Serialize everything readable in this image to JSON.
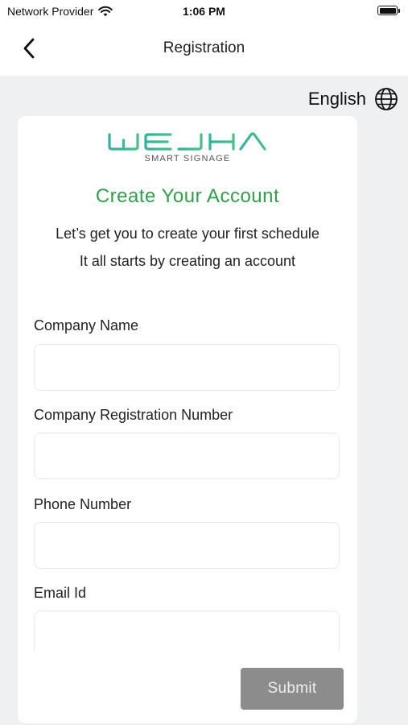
{
  "status_bar": {
    "carrier": "Network Provider",
    "time": "1:06 PM",
    "icons": [
      "wifi-icon",
      "battery-icon"
    ]
  },
  "nav": {
    "title": "Registration",
    "back_icon": "chevron-left-icon"
  },
  "language": {
    "label": "English",
    "icon": "globe-icon"
  },
  "logo": {
    "name": "WEJHA",
    "tagline": "SMART SIGNAGE",
    "color": "#3dbb8f"
  },
  "card": {
    "title": "Create Your Account",
    "subtitle_line1": "Let’s get you to create your first schedule",
    "subtitle_line2": "It all starts by creating an account"
  },
  "form": {
    "fields": [
      {
        "label": "Company Name",
        "value": "",
        "placeholder": ""
      },
      {
        "label": "Company Registration Number",
        "value": "",
        "placeholder": ""
      },
      {
        "label": "Phone Number",
        "value": "",
        "placeholder": ""
      },
      {
        "label": "Email Id",
        "value": "",
        "placeholder": ""
      }
    ],
    "submit_label": "Submit"
  },
  "colors": {
    "accent": "#2ea04a",
    "background": "#eef0f2",
    "submit_disabled": "#8c8c8c"
  }
}
